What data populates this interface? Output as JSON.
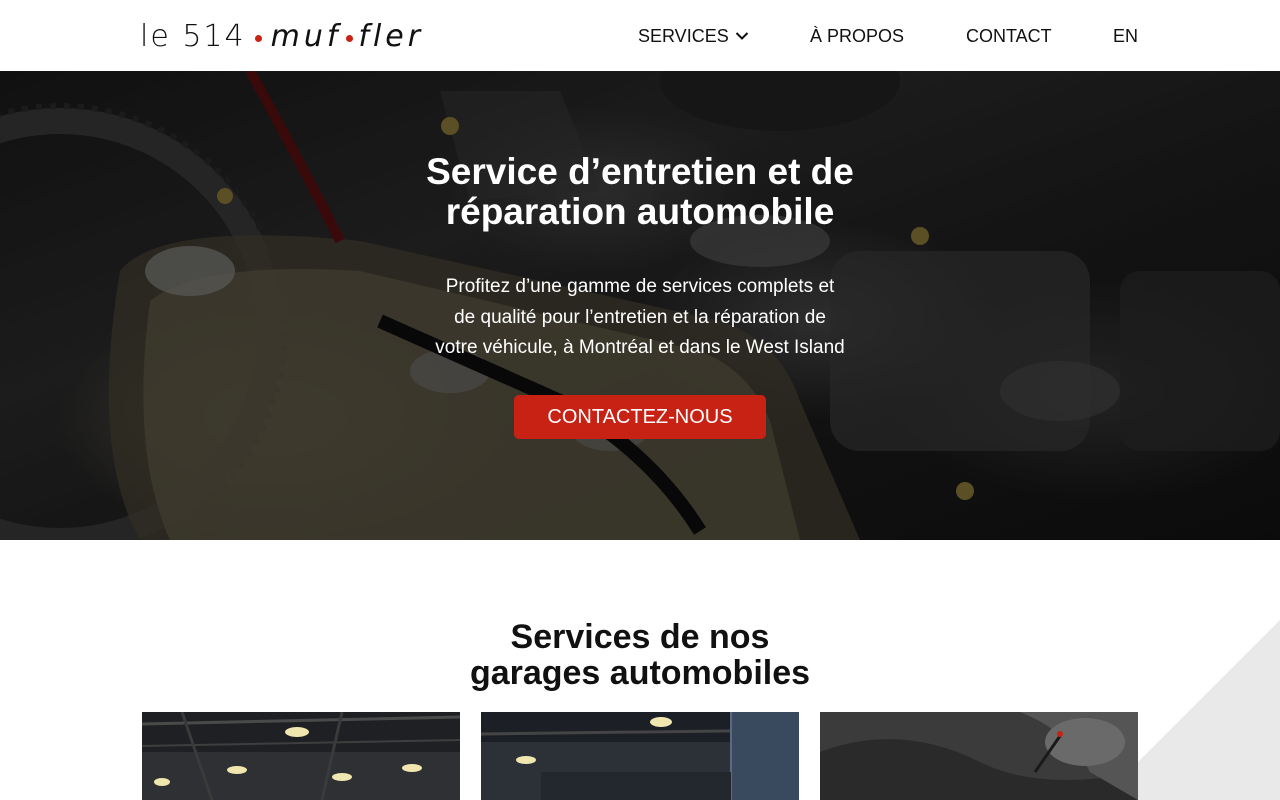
{
  "header": {
    "logo": {
      "part1": "le 514",
      "part2": "muf",
      "part3": "fler"
    },
    "nav": {
      "services": "SERVICES",
      "about": "À PROPOS",
      "contact": "CONTACT",
      "lang": "EN"
    },
    "icons": {
      "services_dropdown": "chevron-down-icon"
    }
  },
  "hero": {
    "title_line1": "Service d’entretien et de",
    "title_line2": "réparation automobile",
    "subtitle_line1": "Profitez d’une gamme de services complets et",
    "subtitle_line2": "de qualité pour l’entretien et la réparation de",
    "subtitle_line3": "votre véhicule, à Montréal et dans le West Island",
    "cta": "CONTACTEZ-NOUS"
  },
  "services": {
    "title_line1": "Services de nos",
    "title_line2": "garages automobiles"
  },
  "colors": {
    "accent": "#c82214",
    "text": "#111111",
    "background": "#ffffff"
  }
}
